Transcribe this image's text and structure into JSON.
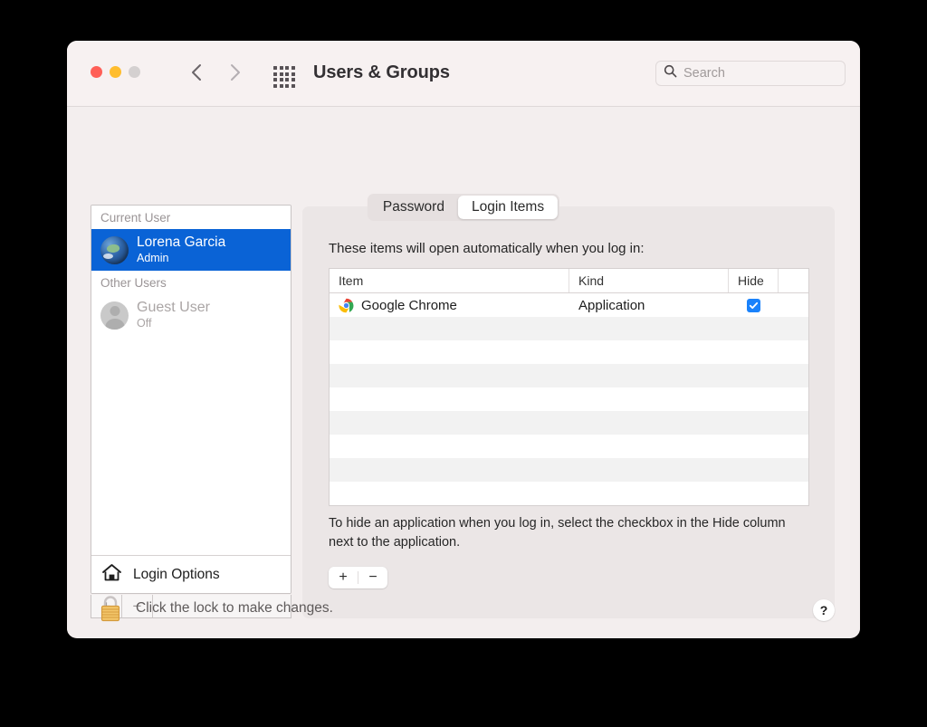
{
  "window": {
    "title": "Users & Groups",
    "traffic_lights": [
      "close",
      "minimize",
      "zoom"
    ],
    "colors": {
      "accent_blue": "#0a63d6",
      "checkbox_blue": "#1a82fb",
      "window_bg": "#f3eeee",
      "panel_bg": "#ebe6e6",
      "toolbar_bg": "#f7f1f1"
    }
  },
  "toolbar": {
    "back_icon": "chevron-left-icon",
    "forward_icon": "chevron-right-icon",
    "grid_icon": "grid-view-icon",
    "search": {
      "placeholder": "Search",
      "value": "",
      "icon": "search-icon"
    }
  },
  "sidebar": {
    "groups": [
      {
        "header": "Current User",
        "users": [
          {
            "name": "Lorena Garcia",
            "role": "Admin",
            "avatar": "globe-avatar",
            "selected": true
          }
        ]
      },
      {
        "header": "Other Users",
        "users": [
          {
            "name": "Guest User",
            "role": "Off",
            "avatar": "person-avatar",
            "selected": false
          }
        ]
      }
    ],
    "login_options": {
      "label": "Login Options",
      "icon": "home-icon"
    },
    "buttons": {
      "add": "+",
      "remove": "−"
    }
  },
  "tabs": [
    {
      "label": "Password",
      "active": false
    },
    {
      "label": "Login Items",
      "active": true
    }
  ],
  "panel": {
    "intro": "These items will open automatically when you log in:",
    "note": "To hide an application when you log in, select the checkbox in the Hide column next to the application.",
    "add_button": "+",
    "remove_button": "−",
    "table": {
      "columns": [
        "Item",
        "Kind",
        "Hide"
      ],
      "rows": [
        {
          "item": "Google Chrome",
          "icon": "chrome-icon",
          "kind": "Application",
          "hide": true
        }
      ],
      "empty_row_count": 8
    }
  },
  "footer": {
    "lock_icon": "lock-closed-icon",
    "lock_text": "Click the lock to make changes.",
    "help_label": "?"
  }
}
